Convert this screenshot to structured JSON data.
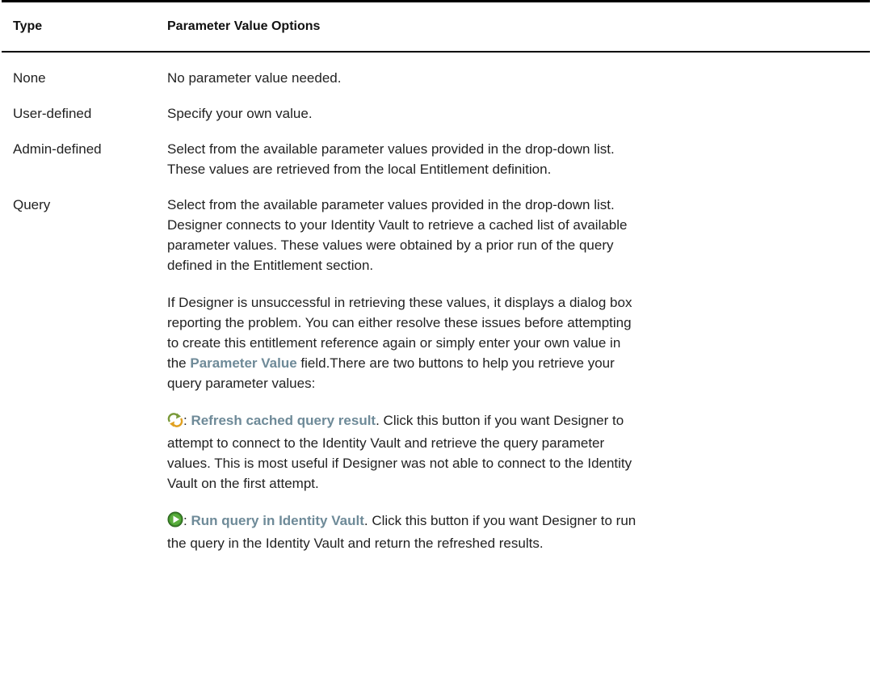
{
  "table": {
    "headers": {
      "type": "Type",
      "options": "Parameter Value Options"
    },
    "rows": [
      {
        "type": "None",
        "text": "No parameter value needed."
      },
      {
        "type": "User-defined",
        "text": "Specify your own value."
      },
      {
        "type": "Admin-defined",
        "line1": "Select from the available parameter values provided in the drop-down list.",
        "line2": "These values are retrieved from the local Entitlement definition."
      },
      {
        "type": "Query",
        "p1": {
          "l1": "Select from the available parameter values provided in the drop-down list.",
          "l2": "Designer connects to your Identity Vault to retrieve a cached list of available",
          "l3": "parameter values. These values were obtained by a prior run of the query",
          "l4": "defined in the Entitlement section."
        },
        "p2": {
          "l1": "If Designer is unsuccessful in retrieving these values, it displays a dialog box",
          "l2": "reporting the problem. You can either resolve these issues before attempting",
          "l3": "to create this entitlement reference again or simply enter your own value in",
          "l4_pre": "the ",
          "l4_ui": "Parameter Value",
          "l4_post": " field.There are two buttons to help you retrieve your",
          "l5": "query parameter values:"
        },
        "p3": {
          "sep": ": ",
          "ui": "Refresh cached query result",
          "l1_post": ". Click this button if you want Designer to",
          "l2": "attempt to connect to the Identity Vault and retrieve the query parameter",
          "l3": "values. This is most useful if Designer was not able to connect to the Identity",
          "l4": "Vault on the first attempt."
        },
        "p4": {
          "sep": ": ",
          "ui": "Run query in Identity Vault",
          "l1_post": ". Click this button if you want Designer to run",
          "l2": "the query in the Identity Vault and return the refreshed results."
        }
      }
    ]
  }
}
